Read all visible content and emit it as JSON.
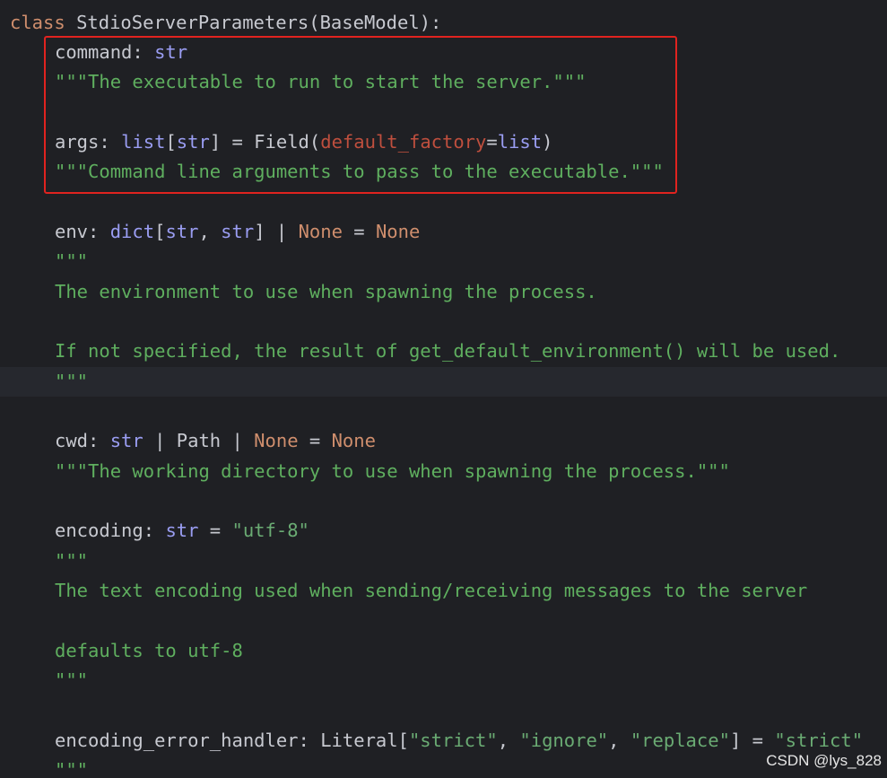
{
  "code": {
    "l1": {
      "kw": "class",
      "name": "StdioServerParameters",
      "open": "(",
      "base": "BaseModel",
      "close": "):"
    },
    "l2": {
      "name": "command",
      "colon": ": ",
      "type": "str"
    },
    "l3": {
      "doc": "\"\"\"The executable to run to start the server.\"\"\""
    },
    "l5": {
      "name": "args",
      "colon": ": ",
      "t1": "list",
      "b1": "[",
      "t2": "str",
      "b2": "] = Field(",
      "param": "default_factory",
      "eq": "=",
      "val": "list",
      "close": ")"
    },
    "l6": {
      "doc": "\"\"\"Command line arguments to pass to the executable.\"\"\""
    },
    "l8": {
      "name": "env",
      "colon": ": ",
      "t1": "dict",
      "b1": "[",
      "t2": "str",
      "comma": ", ",
      "t3": "str",
      "b2": "] | ",
      "n1": "None",
      "eq": " = ",
      "n2": "None"
    },
    "l9": {
      "doc": "\"\"\""
    },
    "l10": {
      "doc": "The environment to use when spawning the process."
    },
    "l12": {
      "doc": "If not specified, the result of get_default_environment() will be used."
    },
    "l13": {
      "doc": "\"\"\""
    },
    "l15": {
      "name": "cwd",
      "colon": ": ",
      "t1": "str",
      "pipe1": " | Path | ",
      "n1": "None",
      "eq": " = ",
      "n2": "None"
    },
    "l16": {
      "doc": "\"\"\"The working directory to use when spawning the process.\"\"\""
    },
    "l18": {
      "name": "encoding",
      "colon": ": ",
      "t1": "str",
      "eq": " = ",
      "val": "\"utf-8\""
    },
    "l19": {
      "doc": "\"\"\""
    },
    "l20": {
      "doc": "The text encoding used when sending/receiving messages to the server"
    },
    "l22": {
      "doc": "defaults to utf-8"
    },
    "l23": {
      "doc": "\"\"\""
    },
    "l25": {
      "name": "encoding_error_handler",
      "colon": ": ",
      "lit": "Literal[",
      "s1": "\"strict\"",
      "c1": ", ",
      "s2": "\"ignore\"",
      "c2": ", ",
      "s3": "\"replace\"",
      "close": "] = ",
      "val": "\"strict\""
    },
    "l26": {
      "doc": "\"\"\""
    }
  },
  "watermark": "CSDN @lys_828",
  "colors": {
    "background": "#1f2024",
    "keyword": "#cf8e6d",
    "type": "#9a9df2",
    "string": "#6aab73",
    "docstring": "#5faf5f",
    "parameter": "#bf4f3e",
    "highlight_border": "#e0231f"
  }
}
